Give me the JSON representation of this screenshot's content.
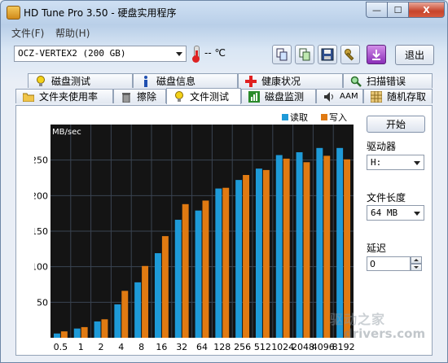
{
  "window": {
    "title": "HD Tune Pro 3.50 - 硬盘实用程序",
    "min_label": "—",
    "max_label": "☐",
    "close_label": "X"
  },
  "menu": {
    "file": "文件(F)",
    "help": "帮助(H)"
  },
  "toolbar": {
    "drive": "OCZ-VERTEX2  (200 GB)",
    "temperature": "-- ℃",
    "exit_label": "退出"
  },
  "tabs_top": [
    "磁盘测试",
    "磁盘信息",
    "健康状况",
    "扫描错误"
  ],
  "tabs_bottom": [
    "文件夹使用率",
    "擦除",
    "文件测试",
    "磁盘监测",
    "AAM",
    "随机存取"
  ],
  "active_tab": "文件测试",
  "controls": {
    "start_label": "开始",
    "drive_label": "驱动器",
    "drive_value": "H:",
    "length_label": "文件长度",
    "length_value": "64 MB",
    "delay_label": "延迟",
    "delay_value": "0"
  },
  "colors": {
    "read": "#1e9ad8",
    "write": "#e07a12",
    "chart_bg": "#141414",
    "grid": "#3a4452"
  },
  "chart_data": {
    "type": "bar",
    "ylabel": "MB/sec",
    "ylim": [
      0,
      300
    ],
    "yticks": [
      50,
      100,
      150,
      200,
      250
    ],
    "categories": [
      "0.5",
      "1",
      "2",
      "4",
      "8",
      "16",
      "32",
      "64",
      "128",
      "256",
      "512",
      "1024",
      "2048",
      "4096",
      "8192"
    ],
    "series": [
      {
        "name": "读取",
        "values": [
          6,
          13,
          23,
          47,
          78,
          119,
          166,
          179,
          210,
          222,
          238,
          257,
          261,
          267,
          267
        ]
      },
      {
        "name": "写入",
        "values": [
          9,
          15,
          26,
          66,
          101,
          143,
          188,
          193,
          211,
          229,
          236,
          252,
          247,
          256,
          251
        ]
      }
    ],
    "legend_position": "top-right",
    "grid": true
  },
  "watermark": {
    "line1": "驱动之家",
    "line2": "drivers.com"
  }
}
